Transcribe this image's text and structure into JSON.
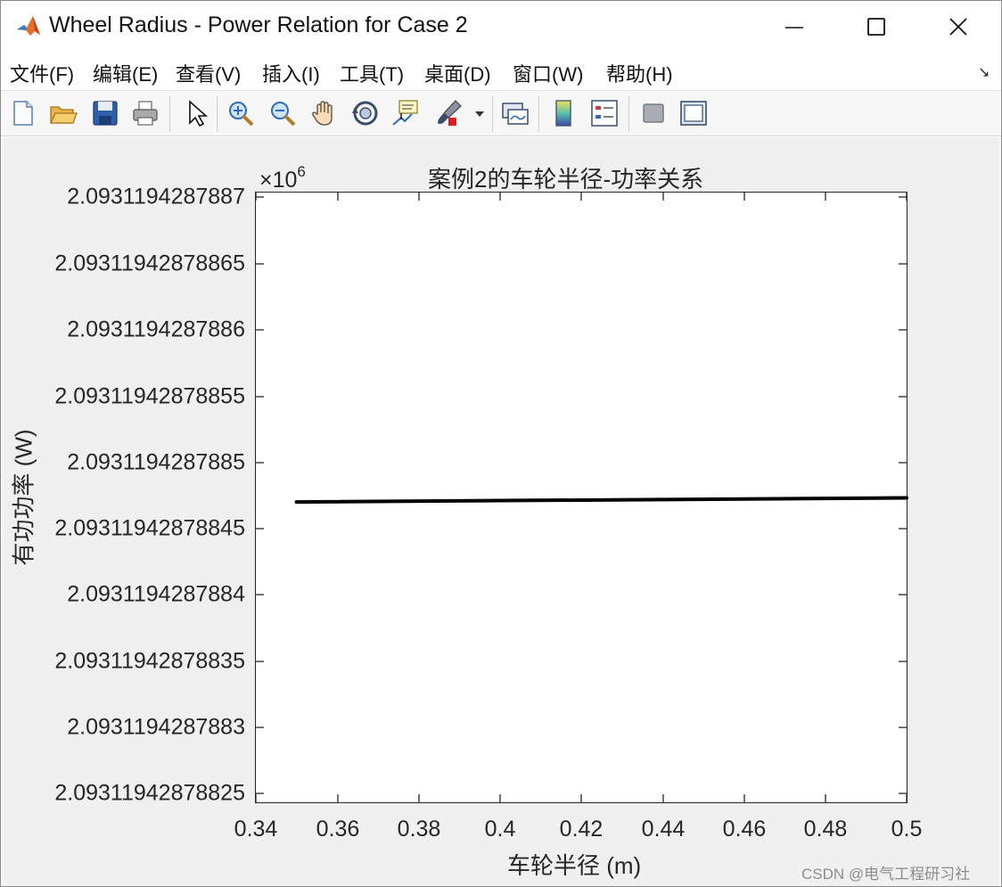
{
  "window": {
    "title": "Wheel Radius - Power Relation for Case 2",
    "app_icon": "matlab-icon",
    "controls": [
      "minimize-icon",
      "maximize-icon",
      "close-icon"
    ]
  },
  "menubar": {
    "items": [
      "文件(F)",
      "编辑(E)",
      "查看(V)",
      "插入(I)",
      "工具(T)",
      "桌面(D)",
      "窗口(W)",
      "帮助(H)"
    ],
    "more_icon": "dock-arrow-icon"
  },
  "toolbar": {
    "icons": [
      "new-figure-icon",
      "open-file-icon",
      "save-icon",
      "print-icon",
      "edit-plot-pointer-icon",
      "zoom-in-icon",
      "zoom-out-icon",
      "pan-hand-icon",
      "rotate-3d-icon",
      "data-cursor-icon",
      "brush-icon",
      "link-plot-icon",
      "colorbar-icon",
      "legend-icon",
      "hide-plot-tools-icon",
      "show-plot-tools-icon"
    ]
  },
  "chart": {
    "title": "案例2的车轮半径-功率关系",
    "exponent_label": "×10",
    "exponent_power": "6",
    "xlabel": "车轮半径 (m)",
    "ylabel": "有功功率 (W)",
    "yticks": [
      "2.0931194287887",
      "2.09311942878865",
      "2.0931194287886",
      "2.09311942878855",
      "2.0931194287885",
      "2.09311942878845",
      "2.0931194287884",
      "2.09311942878835",
      "2.0931194287883",
      "2.09311942878825"
    ],
    "xticks": [
      "0.34",
      "0.36",
      "0.38",
      "0.4",
      "0.42",
      "0.44",
      "0.46",
      "0.48",
      "0.5"
    ]
  },
  "chart_data": {
    "type": "line",
    "title": "案例2的车轮半径-功率关系",
    "xlabel": "车轮半径 (m)",
    "ylabel": "有功功率 (W)",
    "y_multiplier": "×10^6",
    "xlim": [
      0.34,
      0.5
    ],
    "ylim": [
      2.09311942878823,
      2.0931194287887
    ],
    "series": [
      {
        "x": [
          0.35,
          0.5
        ],
        "y": [
          2.09311942878847,
          2.093119428788473
        ],
        "color": "#000000"
      }
    ],
    "grid": false,
    "legend": "none"
  },
  "watermark": "CSDN @电气工程研习社",
  "colors": {
    "figure_bg": "#f0f0f0",
    "axes_bg": "#ffffff",
    "line": "#000000",
    "axis": "#262626"
  }
}
